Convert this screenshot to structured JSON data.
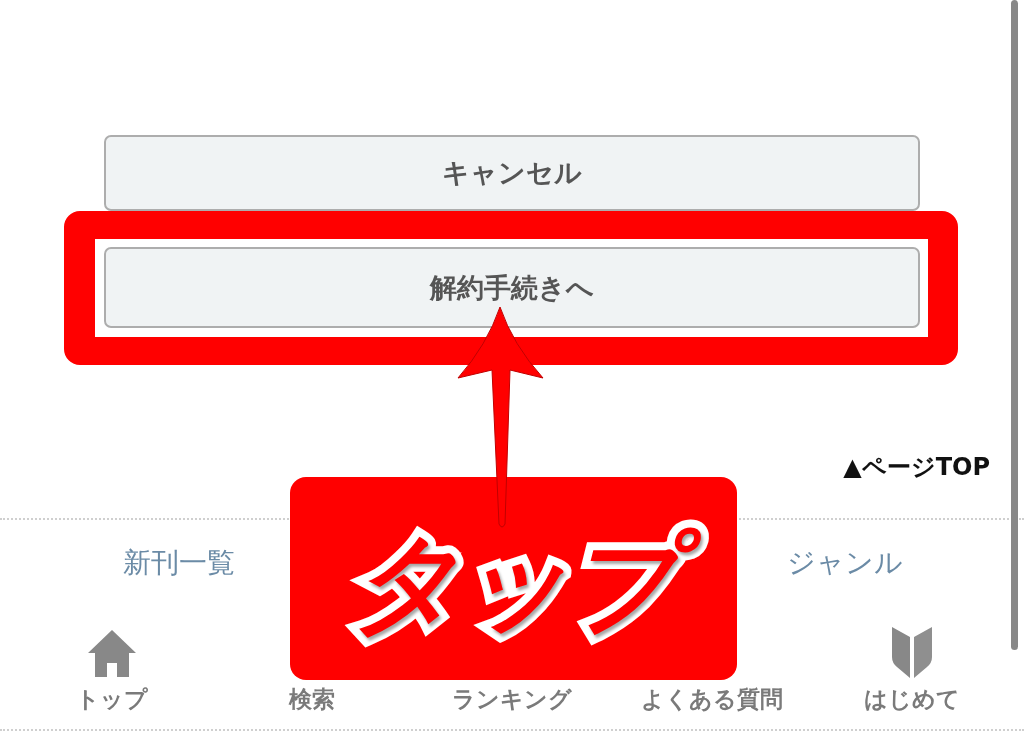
{
  "buttons": [
    {
      "label": "キャンセル",
      "highlighted": false
    },
    {
      "label": "解約手続きへ",
      "highlighted": true
    }
  ],
  "annotation": {
    "callout": "タップ"
  },
  "page_top_link": "▲ページTOP",
  "category_nav": [
    "新刊一覧",
    "ジャンル"
  ],
  "tab_bar": [
    {
      "label": "トップ"
    },
    {
      "label": "検索"
    },
    {
      "label": "ランキング"
    },
    {
      "label": "よくある質問"
    },
    {
      "label": "はじめて"
    }
  ]
}
